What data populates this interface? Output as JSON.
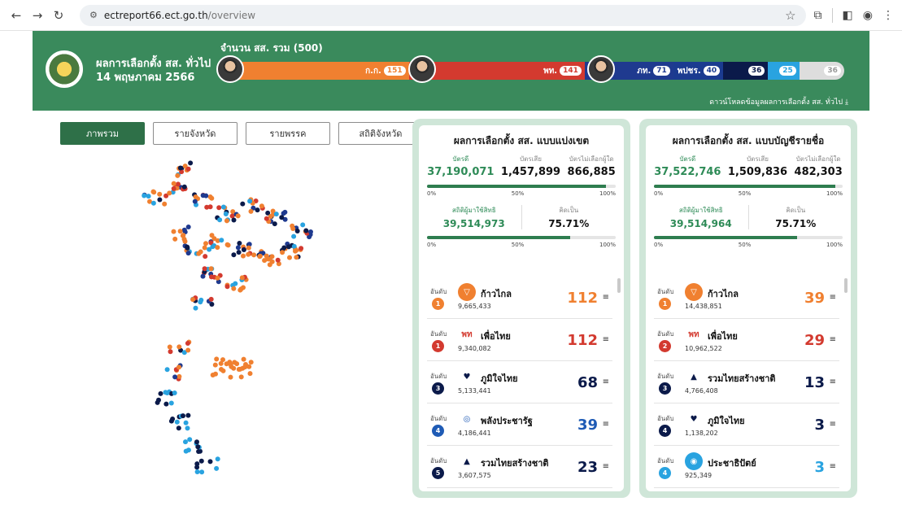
{
  "browser": {
    "url_host": "ectreport66.ect.go.th",
    "url_path": "/overview"
  },
  "header": {
    "title_line1": "ผลการเลือกตั้ง สส. ทั่วไป",
    "title_line2": "14 พฤษภาคม 2566",
    "seat_total_label": "จำนวน สส. รวม (500)",
    "download_label": "ดาวน์โหลดข้อมูลผลการเลือกตั้ง สส. ทั่วไป",
    "seat_segments": [
      {
        "abbr": "ก.ก.",
        "seats": "151",
        "color": "#f08030",
        "share": 0.302
      },
      {
        "abbr": "พท.",
        "seats": "141",
        "color": "#d33a2f",
        "share": 0.282
      },
      {
        "abbr": "ภท.",
        "seats": "71",
        "color": "#1f3a8f",
        "share": 0.142
      },
      {
        "abbr": "พปชร.",
        "seats": "40",
        "color": "#1b3b90",
        "share": 0.08
      },
      {
        "abbr": "",
        "seats": "36",
        "color": "#0b1a4a",
        "share": 0.072
      },
      {
        "abbr": "",
        "seats": "25",
        "color": "#29a3e0",
        "share": 0.05
      },
      {
        "abbr": "",
        "seats": "36",
        "color": "#dddddd",
        "share": 0.072
      }
    ]
  },
  "tabs": [
    {
      "label": "ภาพรวม",
      "active": true
    },
    {
      "label": "รายจังหวัด",
      "active": false
    },
    {
      "label": "รายพรรค",
      "active": false
    },
    {
      "label": "สถิติจังหวัด",
      "active": false
    }
  ],
  "cards": [
    {
      "title": "ผลการเลือกตั้ง สส. แบบแบ่งเขต",
      "good_label": "บัตรดี",
      "good": "37,190,071",
      "bad_label": "บัตรเสีย",
      "bad": "1,457,899",
      "none_label": "บัตรไม่เลือกผู้ใด",
      "none": "866,885",
      "bar1_fraction": 0.95,
      "scale": [
        "0%",
        "50%",
        "100%"
      ],
      "turnout_label": "สถิติผู้มาใช้สิทธิ",
      "turnout": "39,514,973",
      "percent_label": "คิดเป็น",
      "percent": "75.71%",
      "bar2_fraction": 0.757,
      "parties": [
        {
          "rank_label": "อันดับ",
          "rank": "1",
          "rank_color": "#f08030",
          "name": "ก้าวไกล",
          "votes": "9,665,433",
          "seats": "112",
          "seat_color": "#f08030",
          "logo_bg": "#f08030",
          "logo_text": "▽"
        },
        {
          "rank_label": "อันดับ",
          "rank": "1",
          "rank_color": "#d33a2f",
          "name": "เพื่อไทย",
          "votes": "9,340,082",
          "seats": "112",
          "seat_color": "#d33a2f",
          "logo_bg": "#ffffff",
          "logo_text": "พท"
        },
        {
          "rank_label": "อันดับ",
          "rank": "3",
          "rank_color": "#0b1a4a",
          "name": "ภูมิใจไทย",
          "votes": "5,133,441",
          "seats": "68",
          "seat_color": "#0b1a4a",
          "logo_bg": "#ffffff",
          "logo_text": "♥"
        },
        {
          "rank_label": "อันดับ",
          "rank": "4",
          "rank_color": "#1f5bb5",
          "name": "พลังประชารัฐ",
          "votes": "4,186,441",
          "seats": "39",
          "seat_color": "#1f5bb5",
          "logo_bg": "#ffffff",
          "logo_text": "◎"
        },
        {
          "rank_label": "อันดับ",
          "rank": "5",
          "rank_color": "#0b1a4a",
          "name": "รวมไทยสร้างชาติ",
          "votes": "3,607,575",
          "seats": "23",
          "seat_color": "#0b1a4a",
          "logo_bg": "#ffffff",
          "logo_text": "▲"
        }
      ]
    },
    {
      "title": "ผลการเลือกตั้ง สส. แบบบัญชีรายชื่อ",
      "good_label": "บัตรดี",
      "good": "37,522,746",
      "bad_label": "บัตรเสีย",
      "bad": "1,509,836",
      "none_label": "บัตรไม่เลือกผู้ใด",
      "none": "482,303",
      "bar1_fraction": 0.96,
      "scale": [
        "0%",
        "50%",
        "100%"
      ],
      "turnout_label": "สถิติผู้มาใช้สิทธิ",
      "turnout": "39,514,964",
      "percent_label": "คิดเป็น",
      "percent": "75.71%",
      "bar2_fraction": 0.757,
      "parties": [
        {
          "rank_label": "อันดับ",
          "rank": "1",
          "rank_color": "#f08030",
          "name": "ก้าวไกล",
          "votes": "14,438,851",
          "seats": "39",
          "seat_color": "#f08030",
          "logo_bg": "#f08030",
          "logo_text": "▽"
        },
        {
          "rank_label": "อันดับ",
          "rank": "2",
          "rank_color": "#d33a2f",
          "name": "เพื่อไทย",
          "votes": "10,962,522",
          "seats": "29",
          "seat_color": "#d33a2f",
          "logo_bg": "#ffffff",
          "logo_text": "พท"
        },
        {
          "rank_label": "อันดับ",
          "rank": "3",
          "rank_color": "#0b1a4a",
          "name": "รวมไทยสร้างชาติ",
          "votes": "4,766,408",
          "seats": "13",
          "seat_color": "#0b1a4a",
          "logo_bg": "#ffffff",
          "logo_text": "▲"
        },
        {
          "rank_label": "อันดับ",
          "rank": "4",
          "rank_color": "#0b1a4a",
          "name": "ภูมิใจไทย",
          "votes": "1,138,202",
          "seats": "3",
          "seat_color": "#0b1a4a",
          "logo_bg": "#ffffff",
          "logo_text": "♥"
        },
        {
          "rank_label": "อันดับ",
          "rank": "4",
          "rank_color": "#29a3e0",
          "name": "ประชาธิปัตย์",
          "votes": "925,349",
          "seats": "3",
          "seat_color": "#29a3e0",
          "logo_bg": "#29a3e0",
          "logo_text": "◉"
        }
      ]
    }
  ]
}
